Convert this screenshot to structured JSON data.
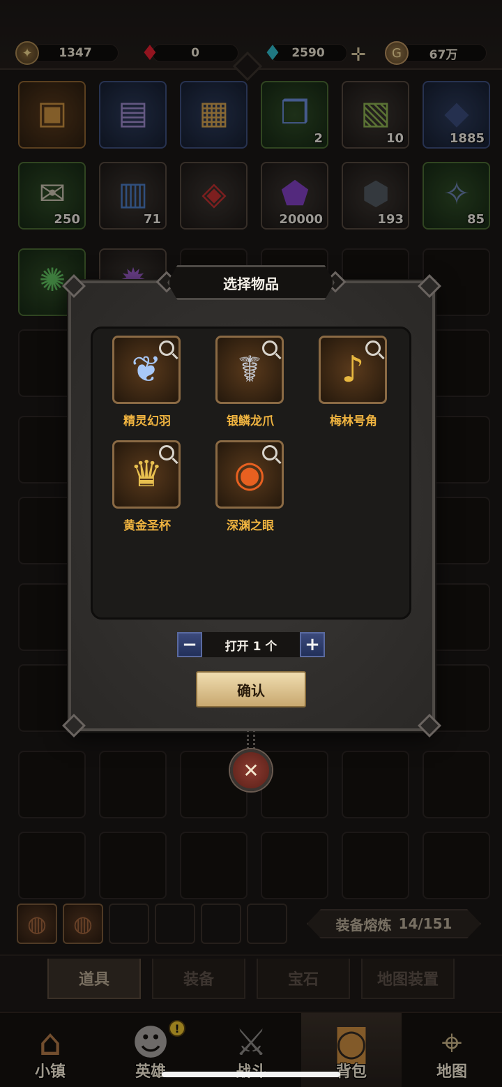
{
  "currencies": {
    "stars": "1347",
    "rubies": "0",
    "diamonds": "2590",
    "gold": "67万"
  },
  "inventory": [
    {
      "icon": "treasure-chest",
      "count": "",
      "quality": "orange"
    },
    {
      "icon": "mask-chest",
      "count": "",
      "quality": "blue"
    },
    {
      "icon": "gem-chest",
      "count": "",
      "quality": "blue"
    },
    {
      "icon": "gift-box",
      "count": "2",
      "quality": "green"
    },
    {
      "icon": "green-chest",
      "count": "10",
      "quality": "gray"
    },
    {
      "icon": "dark-crystal",
      "count": "1885",
      "quality": "blue"
    },
    {
      "icon": "scroll",
      "count": "250",
      "quality": "green"
    },
    {
      "icon": "blue-book",
      "count": "71",
      "quality": "gray"
    },
    {
      "icon": "mystery-gem",
      "count": "",
      "quality": "gray"
    },
    {
      "icon": "purple-crystal",
      "count": "20000",
      "quality": "gray"
    },
    {
      "icon": "black-ore",
      "count": "193",
      "quality": "gray"
    },
    {
      "icon": "rune-stone",
      "count": "85",
      "quality": "green"
    },
    {
      "icon": "green-orb",
      "count": "",
      "quality": "green"
    },
    {
      "icon": "purple-orb",
      "count": "",
      "quality": "gray"
    }
  ],
  "modal": {
    "title": "选择物品",
    "items": [
      {
        "name": "精灵幻羽",
        "icon": "feather-icon"
      },
      {
        "name": "银鳞龙爪",
        "icon": "dragon-claw-icon"
      },
      {
        "name": "梅林号角",
        "icon": "horn-icon"
      },
      {
        "name": "黄金圣杯",
        "icon": "golden-grail-icon"
      },
      {
        "name": "深渊之眼",
        "icon": "abyss-eye-icon"
      }
    ],
    "stepper_minus": "−",
    "stepper_plus": "+",
    "open_label": "打开 1 个",
    "confirm_label": "确认"
  },
  "smelt": {
    "label": "装备熔炼",
    "count": "14/151"
  },
  "tabs": [
    "道具",
    "装备",
    "宝石",
    "地图装置"
  ],
  "nav": [
    {
      "label": "小镇",
      "icon": "town-icon"
    },
    {
      "label": "英雄",
      "icon": "hero-icon"
    },
    {
      "label": "战斗",
      "icon": "battle-icon"
    },
    {
      "label": "背包",
      "icon": "backpack-icon"
    },
    {
      "label": "地图",
      "icon": "map-icon"
    }
  ],
  "hero_badge": "!"
}
